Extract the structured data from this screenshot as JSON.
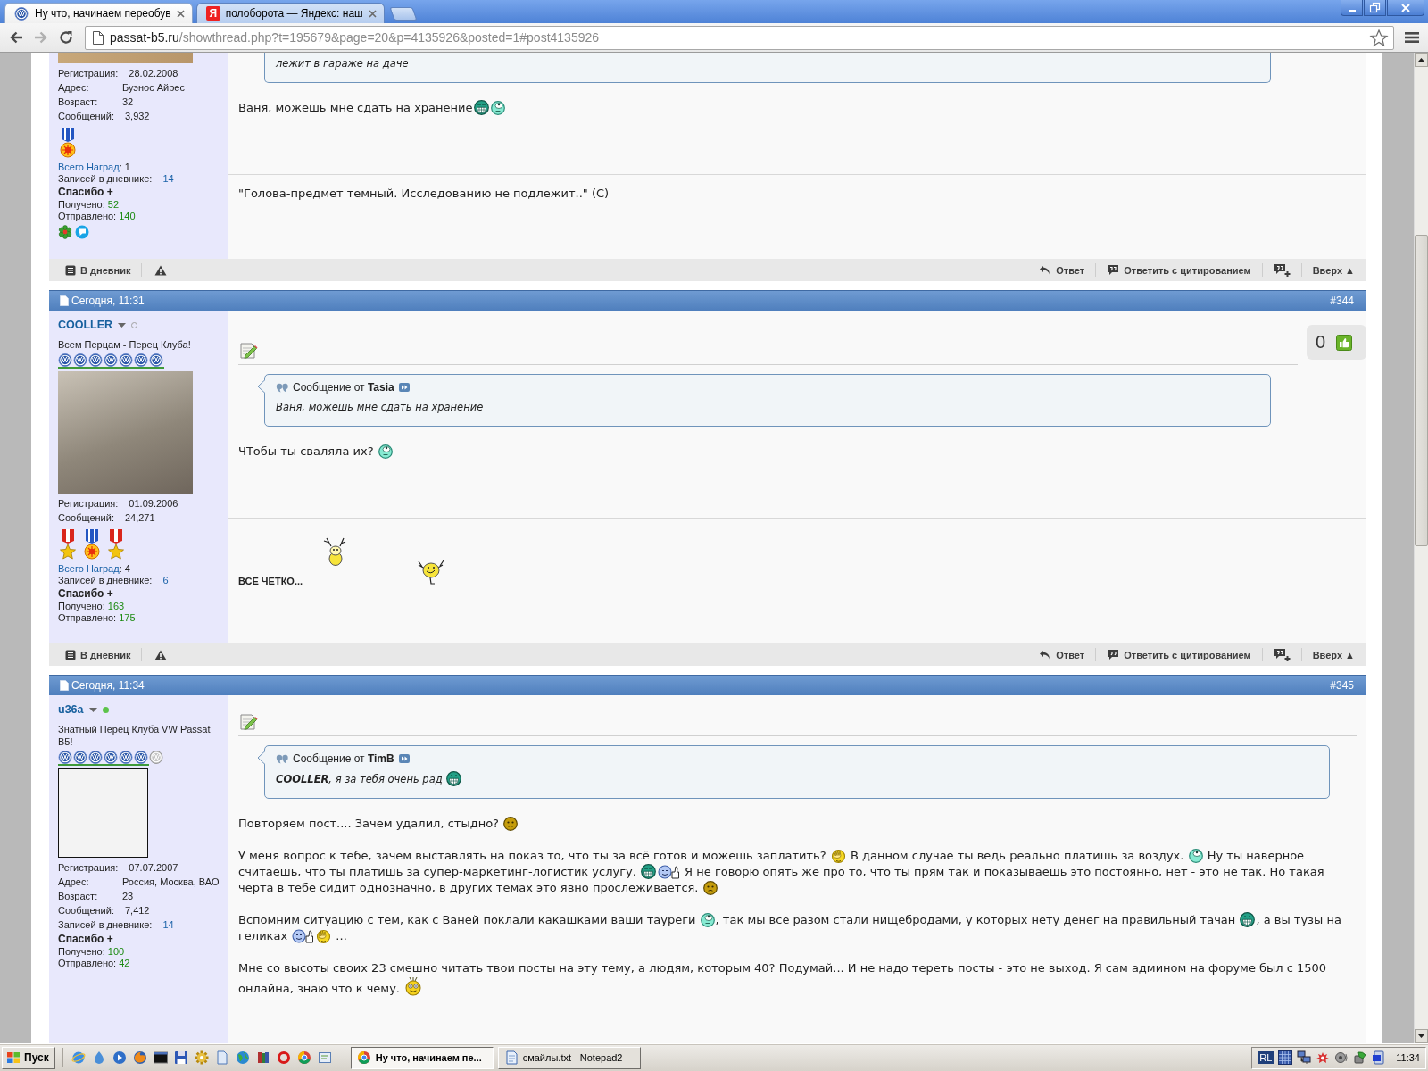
{
  "browser": {
    "tabs": [
      {
        "title": "Ну что, начинаем переобув",
        "selected": true,
        "favicon": {
          "kind": "emblem"
        }
      },
      {
        "title": "полоборота — Яндекс: наш",
        "selected": false,
        "favicon": {
          "kind": "letter",
          "text": "Я"
        }
      }
    ],
    "address": {
      "host": "passat-b5.ru",
      "path": "/showthread.php?t=195679&page=20&p=4135926&posted=1#post4135926"
    }
  },
  "posts": [
    {
      "partial": true,
      "user": {
        "avatar": {
          "kind": "photo_strip"
        },
        "rows": [
          {
            "kind": "detail",
            "label": "Регистрация:",
            "value": "28.02.2008"
          },
          {
            "kind": "detail",
            "label": "Адрес:",
            "value": "Буэнос Айрес"
          },
          {
            "kind": "detail",
            "label": "Возраст:",
            "value": "32"
          },
          {
            "kind": "detail",
            "label": "Сообщений:",
            "value": "3,932"
          },
          {
            "kind": "medals",
            "medals": [
              {
                "kind": "sun"
              }
            ]
          },
          {
            "kind": "awards",
            "label": "Всего Наград",
            "value": ": 1"
          },
          {
            "kind": "diary",
            "label": "Записей в дневнике:",
            "value": "14"
          },
          {
            "kind": "heading",
            "label": "Спасибо +"
          },
          {
            "kind": "count",
            "label": "Получено:",
            "value": "52"
          },
          {
            "kind": "count",
            "label": "Отправлено:",
            "value": "140"
          },
          {
            "kind": "contacts",
            "contacts": [
              {
                "kind": "flower"
              },
              {
                "kind": "messenger"
              }
            ]
          }
        ]
      },
      "quote": {
        "text": [
          {
            "kind": "text",
            "text": "лежит в гараже на даче"
          }
        ]
      },
      "message": [
        [
          {
            "kind": "text",
            "text": "Ваня, можешь мне сдать на хранение"
          },
          {
            "kind": "grin"
          },
          {
            "kind": "eyeroll"
          }
        ]
      ],
      "signature": {
        "kind": "plain",
        "text": "\"Голова-предмет темный. Исследованию не подлежит..\" (C)"
      },
      "footer": {
        "diary": "В дневник",
        "reply": "Ответ",
        "quote": "Ответить с цитированием",
        "top": "Вверх ▲"
      }
    },
    {
      "partial": false,
      "date": "Сегодня, 11:31",
      "number": "#344",
      "user": {
        "name": "COOLLER",
        "online": false,
        "rank": "Всем Перцам - Перец Клуба!",
        "stars": 7,
        "avatar": {
          "kind": "photo"
        },
        "rows": [
          {
            "kind": "detail",
            "label": "Регистрация:",
            "value": "01.09.2006"
          },
          {
            "kind": "detail",
            "label": "Сообщений:",
            "value": "24,271"
          },
          {
            "kind": "medals",
            "medals": [
              {
                "kind": "star"
              },
              {
                "kind": "sun"
              },
              {
                "kind": "star"
              }
            ]
          },
          {
            "kind": "awards",
            "label": "Всего Наград",
            "value": ": 4"
          },
          {
            "kind": "diary",
            "label": "Записей в дневнике:",
            "value": "6"
          },
          {
            "kind": "heading",
            "label": "Спасибо +"
          },
          {
            "kind": "count",
            "label": "Получено:",
            "value": "163"
          },
          {
            "kind": "count",
            "label": "Отправлено:",
            "value": "175"
          }
        ]
      },
      "likes": {
        "count": "0"
      },
      "quote": {
        "label": "Сообщение от **Tasia**",
        "text": [
          {
            "kind": "text",
            "text": "Ваня, можешь мне сдать на хранение"
          }
        ]
      },
      "message": [
        [
          {
            "kind": "text",
            "text": "ЧТобы ты сваляла их? "
          },
          {
            "kind": "eyeroll"
          }
        ]
      ],
      "signature": {
        "kind": "dancers",
        "text": "ВСЕ ЧЕТКО..."
      },
      "footer": {
        "diary": "В дневник",
        "reply": "Ответ",
        "quote": "Ответить с цитированием",
        "top": "Вверх ▲"
      }
    },
    {
      "partial": false,
      "date": "Сегодня, 11:34",
      "number": "#345",
      "user": {
        "name": "u36a",
        "online": true,
        "rank": "Знатный Перец Клуба VW Passat B5!",
        "stars": 6,
        "avatar": {
          "kind": "drawing"
        },
        "rows": [
          {
            "kind": "detail",
            "label": "Регистрация:",
            "value": "07.07.2007"
          },
          {
            "kind": "detail",
            "label": "Адрес:",
            "value": "Россия, Москва, ВАО"
          },
          {
            "kind": "detail",
            "label": "Возраст:",
            "value": "23"
          },
          {
            "kind": "detail",
            "label": "Сообщений:",
            "value": "7,412"
          },
          {
            "kind": "detail_link",
            "label": "Записей в дневнике:",
            "value": "14"
          },
          {
            "kind": "heading",
            "label": "Спасибо +"
          },
          {
            "kind": "count",
            "label": "Получено:",
            "value": "100"
          },
          {
            "kind": "count",
            "label": "Отправлено:",
            "value": "42"
          }
        ]
      },
      "quote": {
        "label": "Сообщение от **TimB**",
        "text": [
          {
            "kind": "text",
            "text": "**COOLLER**, я за тебя очень рад "
          },
          {
            "kind": "grin"
          }
        ]
      },
      "message": [
        [
          {
            "kind": "text",
            "text": "Повторяем пост.... Зачем удалил, стыдно? "
          },
          {
            "kind": "shame"
          }
        ],
        [
          {
            "kind": "text",
            "text": "У меня вопрос к тебе, зачем выставлять на показ то, что ты за всё готов и можешь заплатить? "
          },
          {
            "kind": "facepalm"
          },
          {
            "kind": "text",
            "text": " В данном случае ты ведь реально платишь за воздух. "
          },
          {
            "kind": "eyeroll"
          },
          {
            "kind": "text",
            "text": " Ну ты наверное считаешь, что ты платишь за супер-маркетинг-логистик услугу. "
          },
          {
            "kind": "grin"
          },
          {
            "kind": "thumbs"
          },
          {
            "kind": "text",
            "text": " Я не говорю опять же про то, что ты прям так и показываешь это постоянно, нет - это не так. Но такая черта в тебе сидит однозначно, в других темах это явно прослеживается. "
          },
          {
            "kind": "shame"
          }
        ],
        [
          {
            "kind": "text",
            "text": "Вспомним ситуацию с тем, как с Ваней поклали какашками ваши тауреги "
          },
          {
            "kind": "eyeroll"
          },
          {
            "kind": "text",
            "text": ", так мы все разом стали нищебродами, у которых нету денег на правильный тачан "
          },
          {
            "kind": "grin"
          },
          {
            "kind": "text",
            "text": ", а вы тузы на геликах "
          },
          {
            "kind": "thumbs"
          },
          {
            "kind": "facepalm"
          },
          {
            "kind": "text",
            "text": " ..."
          }
        ],
        [
          {
            "kind": "text",
            "text": "Мне со высоты своих 23 смешно читать твои посты на эту тему, а людям, которым 40? Подумай... И не надо тереть посты - это не выход. Я сам админом на форуме был с 1500 онлайна, знаю что к чему. "
          },
          {
            "kind": "hypno"
          }
        ]
      ]
    }
  ],
  "taskbar": {
    "start": "Пуск",
    "tasks": [
      {
        "title": "Ну что, начинаем пе...",
        "selected": true,
        "kind": "browser"
      },
      {
        "title": "смайлы.txt - Notepad2",
        "selected": false,
        "kind": "editor"
      }
    ],
    "tray": {
      "language": "RL",
      "clock": "11:34"
    }
  }
}
